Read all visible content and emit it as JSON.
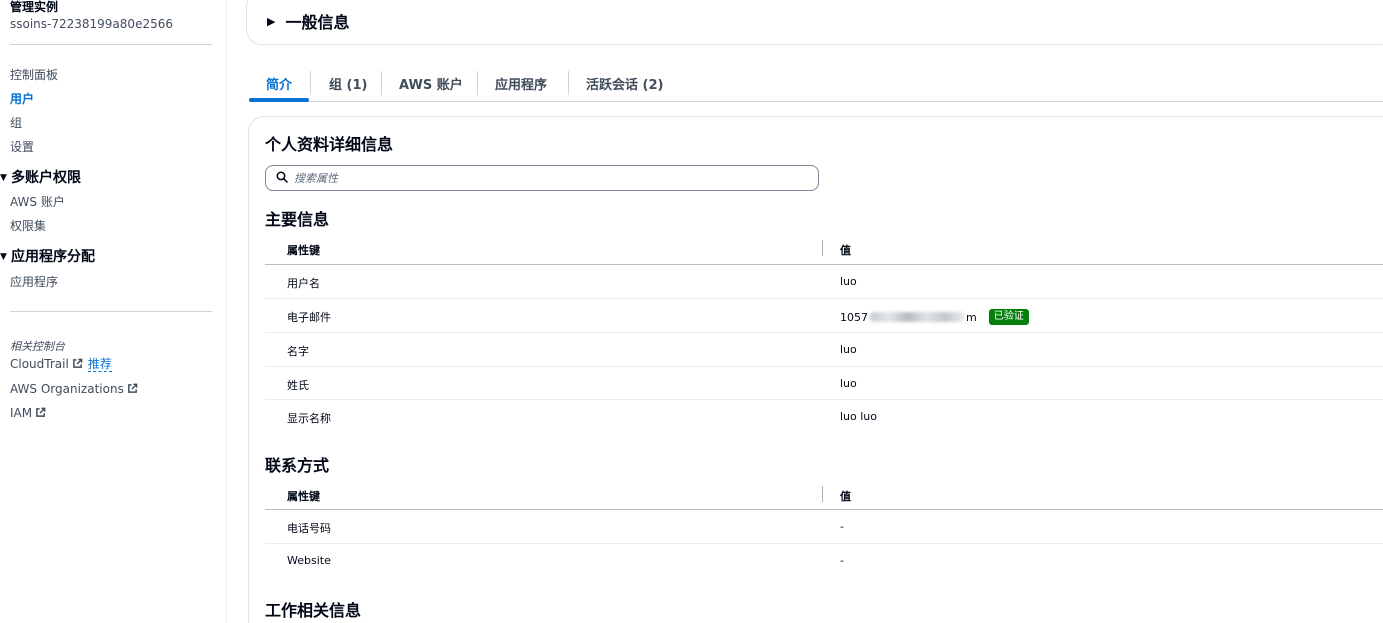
{
  "sidebar": {
    "instance_title": "管理实例",
    "instance_id": "ssoins-72238199a80e2566",
    "items_top": [
      {
        "label": "控制面板"
      },
      {
        "label": "用户"
      },
      {
        "label": "组"
      },
      {
        "label": "设置"
      }
    ],
    "section_multi": {
      "label": "多账户权限",
      "items": [
        {
          "label": "AWS 账户"
        },
        {
          "label": "权限集"
        }
      ]
    },
    "section_app": {
      "label": "应用程序分配",
      "items": [
        {
          "label": "应用程序"
        }
      ]
    },
    "related_title": "相关控制台",
    "related": [
      {
        "label": "CloudTrail",
        "extra": "推荐"
      },
      {
        "label": "AWS Organizations"
      },
      {
        "label": "IAM"
      }
    ]
  },
  "general_info": {
    "title": "一般信息"
  },
  "tabs": [
    {
      "label": "简介"
    },
    {
      "label": "组 (1)"
    },
    {
      "label": "AWS 账户"
    },
    {
      "label": "应用程序"
    },
    {
      "label": "活跃会话 (2)"
    }
  ],
  "profile": {
    "title": "个人资料详细信息",
    "search_placeholder": "搜索属性",
    "primary": {
      "title": "主要信息",
      "col_key": "属性键",
      "col_value": "值",
      "rows": [
        {
          "key": "用户名",
          "value": "luo"
        },
        {
          "key": "电子邮件",
          "value_prefix": "1057",
          "value_suffix": "m",
          "badge": "已验证"
        },
        {
          "key": "名字",
          "value": "luo"
        },
        {
          "key": "姓氏",
          "value": "luo"
        },
        {
          "key": "显示名称",
          "value": "luo luo"
        }
      ]
    },
    "contact": {
      "title": "联系方式",
      "col_key": "属性键",
      "col_value": "值",
      "rows": [
        {
          "key": "电话号码",
          "value": "-"
        },
        {
          "key": "Website",
          "value": "-"
        }
      ]
    },
    "work": {
      "title": "工作相关信息"
    }
  },
  "colors": {
    "accent": "#0972d3",
    "badge_bg": "#037f0c",
    "text": "#000716",
    "muted": "#414d5c"
  },
  "icons": {
    "search": "search-icon",
    "external": "external-link-icon",
    "caret": "caret-down-icon",
    "expand": "caret-right-icon"
  }
}
